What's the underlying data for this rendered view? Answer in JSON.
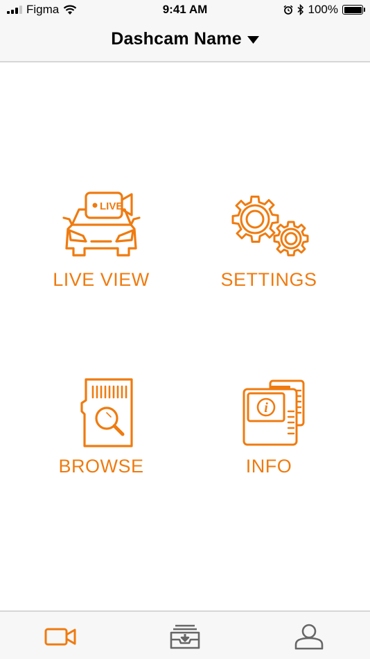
{
  "status_bar": {
    "carrier": "Figma",
    "time": "9:41 AM",
    "battery": "100%",
    "icons": [
      "signal-icon",
      "wifi-icon",
      "alarm-icon",
      "bluetooth-icon",
      "battery-icon"
    ]
  },
  "header": {
    "title": "Dashcam Name",
    "dropdown_icon": "caret-down-icon"
  },
  "menu": {
    "items": [
      {
        "label": "LIVE VIEW",
        "icon": "live-car-camera-icon",
        "badge": "LIVE"
      },
      {
        "label": "SETTINGS",
        "icon": "gears-icon"
      },
      {
        "label": "BROWSE",
        "icon": "sd-card-search-icon"
      },
      {
        "label": "INFO",
        "icon": "info-document-icon"
      }
    ]
  },
  "tab_bar": {
    "items": [
      {
        "icon": "video-camera-icon",
        "active": true
      },
      {
        "icon": "download-tray-icon",
        "active": false
      },
      {
        "icon": "user-profile-icon",
        "active": false
      }
    ]
  },
  "colors": {
    "accent": "#ef7b10",
    "inactive_icon": "#666666",
    "bar_background": "#f7f7f7",
    "divider": "#d6d6d6"
  }
}
